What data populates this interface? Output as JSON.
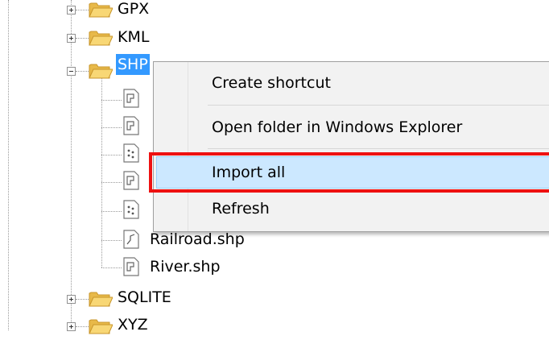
{
  "tree": {
    "nodes": [
      {
        "label": "GPX",
        "expander": "plus"
      },
      {
        "label": "KML",
        "expander": "plus"
      },
      {
        "label": "SHP",
        "expander": "minus",
        "selected": true
      },
      {
        "label": "Railroad.shp"
      },
      {
        "label": "River.shp"
      },
      {
        "label": "SQLITE",
        "expander": "plus"
      },
      {
        "label": "XYZ",
        "expander": "plus"
      }
    ]
  },
  "context_menu": {
    "items": [
      {
        "label": "Create shortcut"
      },
      {
        "label": "Open folder in Windows Explorer"
      },
      {
        "label": "Import all",
        "highlighted": true
      },
      {
        "label": "Refresh"
      }
    ]
  },
  "colors": {
    "selection": "#3399ff",
    "menu_background": "#f2f2f2",
    "menu_hover": "#cce8ff",
    "highlight_box": "#ee1111",
    "folder": "#f8d775"
  },
  "icons": {
    "folder": "folder-icon",
    "polygon_file": "polygon-shapefile-icon",
    "point_file": "point-shapefile-icon",
    "line_file": "line-shapefile-icon"
  }
}
